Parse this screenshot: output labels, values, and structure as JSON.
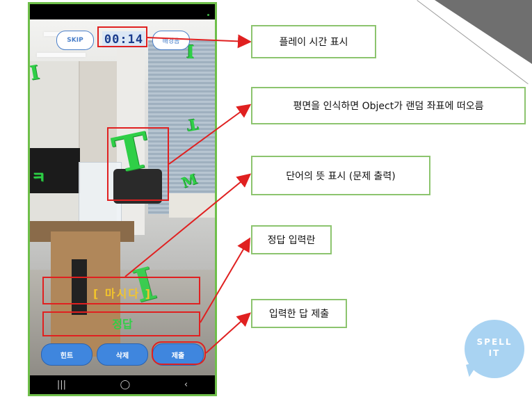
{
  "hud": {
    "skip_label": "SKIP",
    "timer": "00:14",
    "bgm_label": "배경음"
  },
  "ar_scene": {
    "floating_letters": [
      "T",
      "I",
      "I",
      "ㅋ",
      "M",
      "T",
      "I"
    ]
  },
  "question": "[ 마시다 ]",
  "answer_input": "정답",
  "bottom_buttons": {
    "hint": "힌트",
    "delete": "삭제",
    "submit": "제출"
  },
  "nav": {
    "recents": "|||",
    "home": "◯",
    "back": "‹"
  },
  "callouts": {
    "play_time": "플레이 시간 표시",
    "object_spawn": "평면을 인식하면 Object가 랜덤 좌표에 떠오름",
    "meaning": "단어의 뜻 표시 (문제 출력)",
    "answer_field": "정답 입력란",
    "submit": "입력한 답 제출"
  },
  "logo": {
    "line1": "SPELL",
    "line2": "IT",
    "color": "#a9d3f2"
  },
  "colors": {
    "annotation_red": "#e02020",
    "callout_border": "#8cc46e",
    "phone_frame": "#6fbf4a",
    "button_blue": "#3f86de",
    "letter_green": "#2fcf47",
    "question_yellow": "#f2c42c"
  }
}
